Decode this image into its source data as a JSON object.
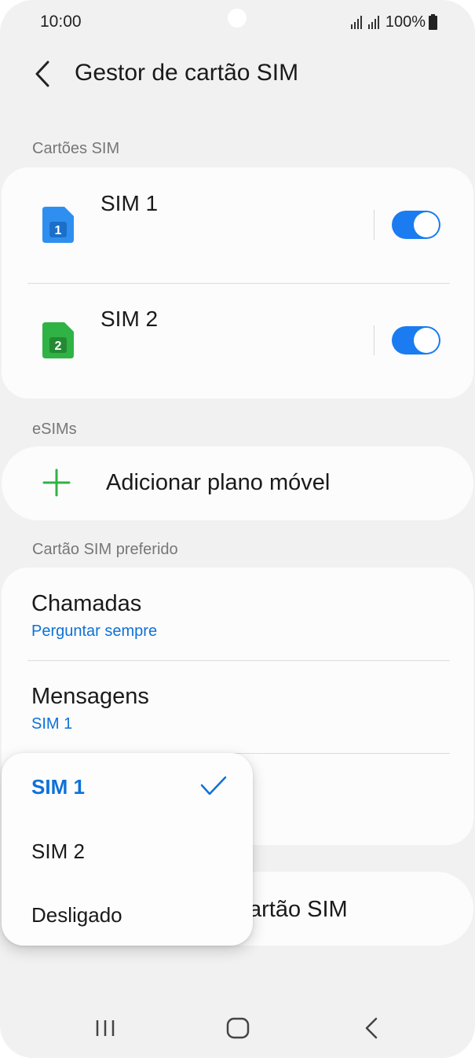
{
  "status_bar": {
    "time": "10:00",
    "battery": "100%"
  },
  "header": {
    "title": "Gestor de cartão SIM"
  },
  "sections": {
    "sim_cards": "Cartões SIM",
    "esims": "eSIMs",
    "preferred": "Cartão SIM preferido"
  },
  "sim_cards": [
    {
      "name": "SIM 1",
      "icon_number": "1",
      "enabled": true,
      "color": "#2f8ff0"
    },
    {
      "name": "SIM 2",
      "icon_number": "2",
      "enabled": true,
      "color": "#2fb344"
    }
  ],
  "esims": {
    "add_label": "Adicionar plano móvel"
  },
  "preferred": [
    {
      "title": "Chamadas",
      "value": "Perguntar sempre"
    },
    {
      "title": "Mensagens",
      "value": "SIM 1"
    }
  ],
  "more_card": {
    "partial_label": "artão SIM"
  },
  "popup": {
    "options": [
      {
        "label": "SIM 1",
        "selected": true
      },
      {
        "label": "SIM 2",
        "selected": false
      },
      {
        "label": "Desligado",
        "selected": false
      }
    ]
  },
  "colors": {
    "accent": "#1a7cf0",
    "link": "#0d71d8",
    "plus": "#2fb344",
    "background": "#f1f1f1"
  }
}
